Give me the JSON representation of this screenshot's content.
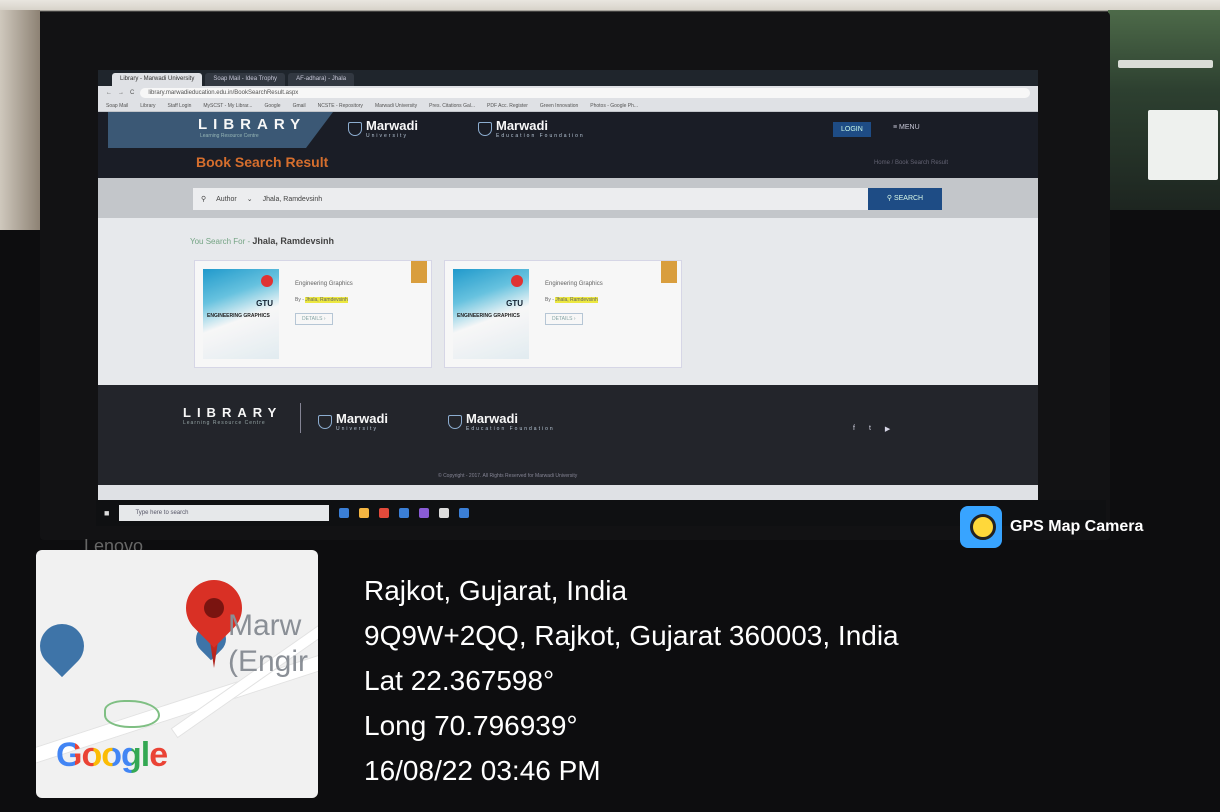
{
  "browser": {
    "tabs": [
      "Library - Marwadi University",
      "Soap Mail - Idea Trophy",
      "AF-adhara) - Jhala"
    ],
    "url": "library.marwadieducation.edu.in/BookSearchResult.aspx",
    "bookmarks": [
      "Soap Mail",
      "Library",
      "Staff Login",
      "MySCST - My Librar...",
      "Google",
      "Gmail",
      "NCSTE - Repository",
      "Marwadi University",
      "Pres. Citations Gal...",
      "PDF Acc. Register",
      "Green Innovation",
      "Photos - Google Ph..."
    ]
  },
  "site": {
    "library_title": "LIBRARY",
    "library_sub": "Learning Resource Centre",
    "brand1": "Marwadi",
    "brand1_sub": "University",
    "brand2": "Marwadi",
    "brand2_sub": "Education Foundation",
    "login": "LOGIN",
    "menu": "≡ MENU",
    "page_title": "Book Search Result",
    "breadcrumb": "Home / Book Search Result",
    "search_field": "Author",
    "search_value": "Jhala, Ramdevsinh",
    "search_button": "SEARCH",
    "you_search_label": "You Search For -",
    "you_search_value": "Jhala, Ramdevsinh",
    "results": [
      {
        "title": "Engineering Graphics",
        "by": "By -",
        "author": "Jhala, Ramdevsinh",
        "details": "DETAILS ›",
        "cover_title": "ENGINEERING GRAPHICS",
        "cover_brand": "GTU"
      },
      {
        "title": "Engineering Graphics",
        "by": "By -",
        "author": "Jhala, Ramdevsinh",
        "details": "DETAILS ›",
        "cover_title": "ENGINEERING GRAPHICS",
        "cover_brand": "GTU"
      }
    ],
    "copyright": "© Copyright - 2017. All Rights Reserved for Marwadi University",
    "social": [
      "f",
      "t",
      "▶"
    ]
  },
  "taskbar": {
    "search_placeholder": "Type here to search"
  },
  "monitor_brand": "Lenovo",
  "gps": {
    "app_name": "GPS Map Camera",
    "city": "Rajkot, Gujarat, India",
    "address": "9Q9W+2QQ, Rajkot, Gujarat 360003, India",
    "lat": "Lat 22.367598°",
    "long": "Long 70.796939°",
    "datetime": "16/08/22 03:46 PM",
    "map_label_line1": "Marw",
    "map_label_line2": "(Engir",
    "map_brand": "Google"
  }
}
